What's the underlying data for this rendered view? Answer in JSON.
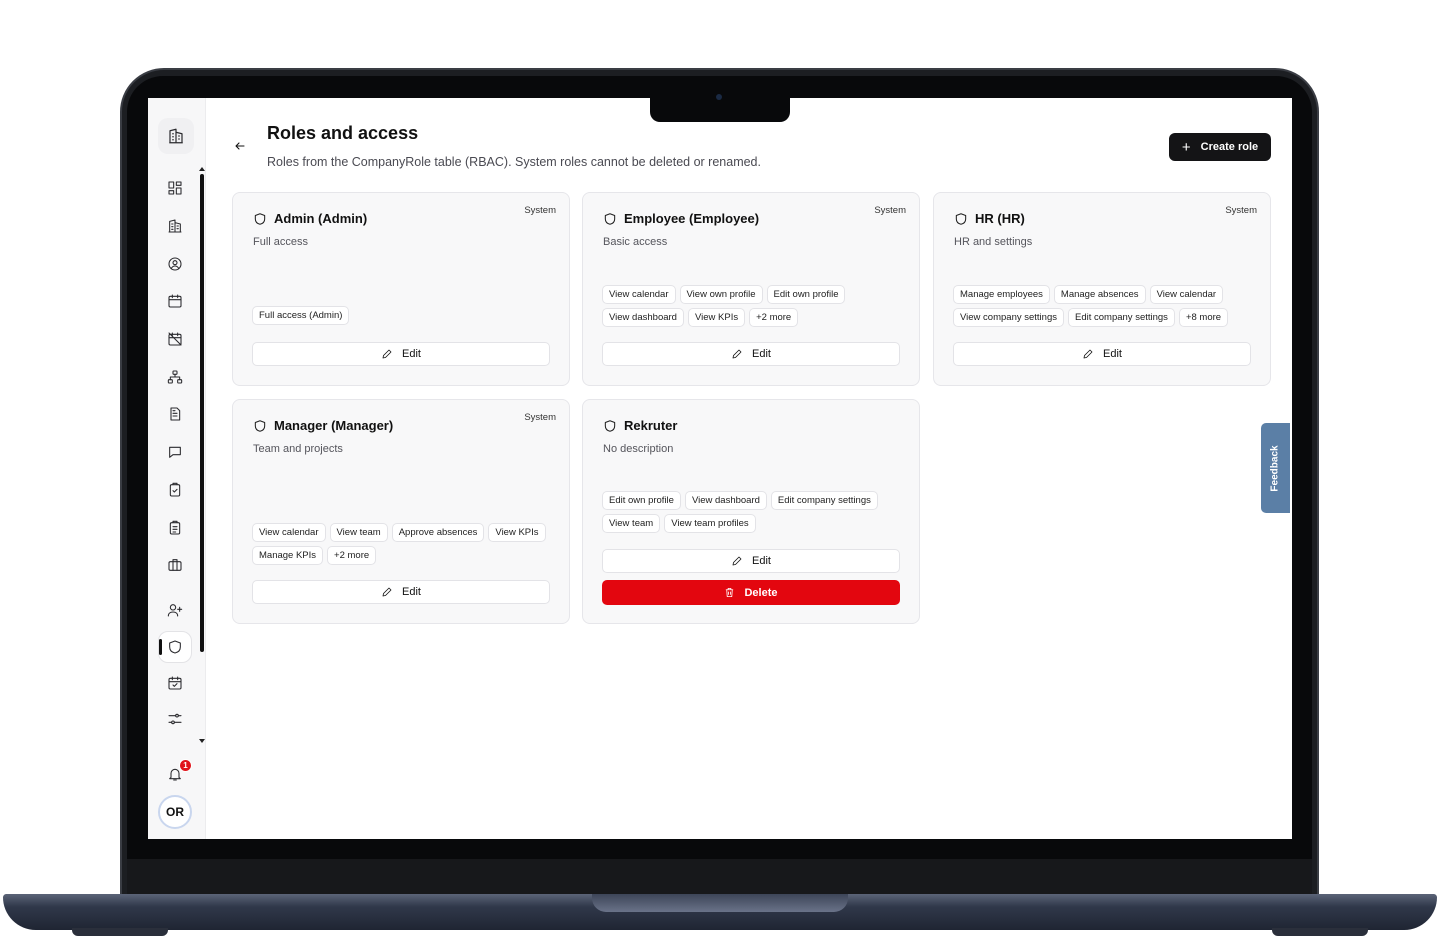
{
  "header": {
    "title": "Roles and access",
    "subtitle": "Roles from the CompanyRole table (RBAC). System roles cannot be deleted or renamed.",
    "create_label": "Create role",
    "create_icon": "plus-icon",
    "back_icon": "arrow-left-icon"
  },
  "sidebar": {
    "logo_icon": "building-icon",
    "items": [
      {
        "icon": "dashboard-icon"
      },
      {
        "icon": "building-icon"
      },
      {
        "icon": "user-circle-icon"
      },
      {
        "icon": "calendar-icon"
      },
      {
        "icon": "calendar-off-icon"
      },
      {
        "icon": "org-chart-icon"
      },
      {
        "icon": "document-icon"
      },
      {
        "icon": "chat-icon"
      },
      {
        "icon": "clipboard-check-icon"
      },
      {
        "icon": "clipboard-list-icon"
      },
      {
        "icon": "briefcase-icon"
      },
      {
        "icon": "user-plus-icon"
      },
      {
        "icon": "shield-icon",
        "active": true
      },
      {
        "icon": "calendar-check-icon"
      },
      {
        "icon": "settings-sliders-icon"
      }
    ],
    "notifications_count": "1",
    "avatar_initials": "OR"
  },
  "roles": [
    {
      "name": "Admin (Admin)",
      "description": "Full access",
      "system_label": "System",
      "permissions": [
        "Full access (Admin)"
      ],
      "edit_label": "Edit"
    },
    {
      "name": "Employee (Employee)",
      "description": "Basic access",
      "system_label": "System",
      "permissions": [
        "View calendar",
        "View own profile",
        "Edit own profile",
        "View dashboard",
        "View KPIs",
        "+2 more"
      ],
      "edit_label": "Edit"
    },
    {
      "name": "HR (HR)",
      "description": "HR and settings",
      "system_label": "System",
      "permissions": [
        "Manage employees",
        "Manage absences",
        "View calendar",
        "View company settings",
        "Edit company settings",
        "+8 more"
      ],
      "edit_label": "Edit"
    },
    {
      "name": "Manager (Manager)",
      "description": "Team and projects",
      "system_label": "System",
      "permissions": [
        "View calendar",
        "View team",
        "Approve absences",
        "View KPIs",
        "Manage KPIs",
        "+2 more"
      ],
      "edit_label": "Edit"
    },
    {
      "name": "Rekruter",
      "description": "No description",
      "system_label": "",
      "permissions": [
        "Edit own profile",
        "View dashboard",
        "Edit company settings",
        "View team",
        "View team profiles"
      ],
      "edit_label": "Edit",
      "delete_label": "Delete"
    }
  ],
  "feedback": {
    "label": "Feedback"
  },
  "colors": {
    "primary": "#141416",
    "danger": "#e3060f",
    "feedback": "#5b7fa6"
  }
}
